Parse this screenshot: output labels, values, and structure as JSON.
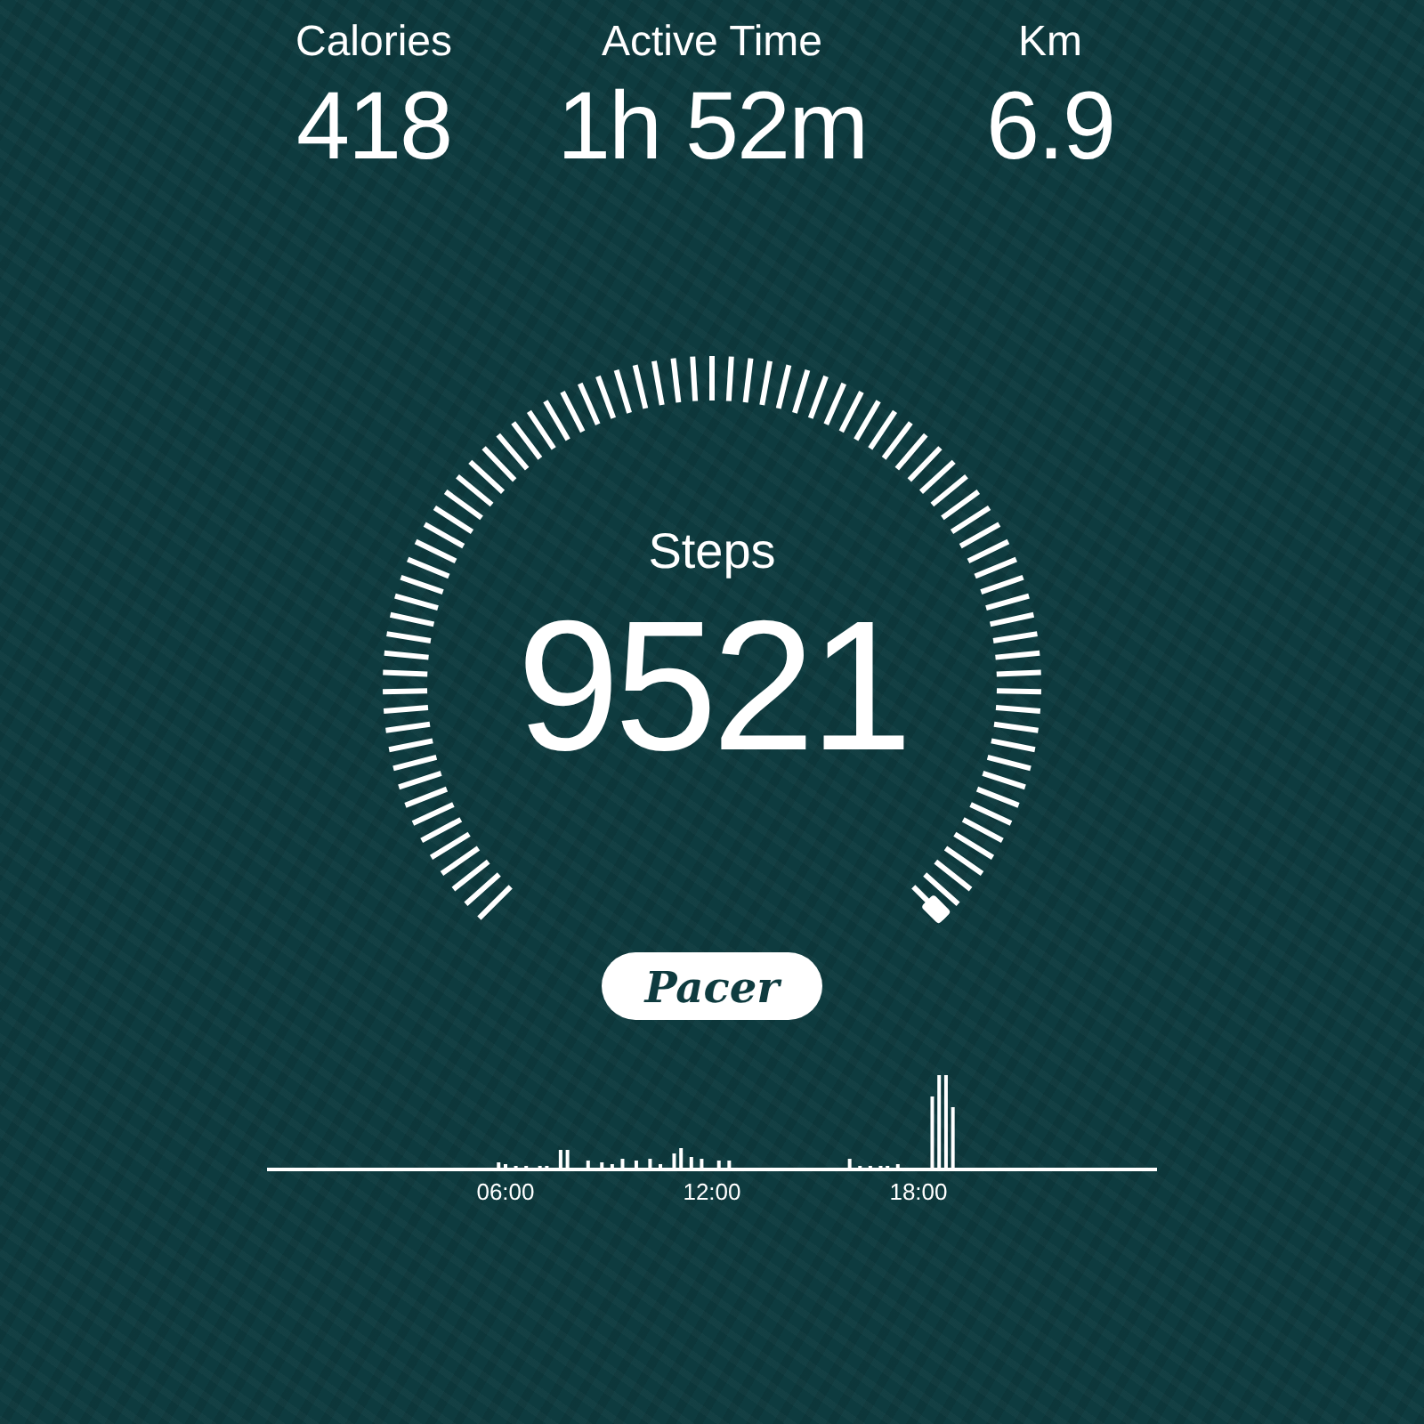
{
  "stats": [
    {
      "label": "Calories",
      "value": "418"
    },
    {
      "label": "Active Time",
      "value": "1h 52m"
    },
    {
      "label": "Km",
      "value": "6.9"
    }
  ],
  "gauge": {
    "label": "Steps",
    "value": "9521"
  },
  "badge": "Pacer",
  "activity": {
    "time_labels": [
      "06:00",
      "12:00",
      "18:00"
    ]
  }
}
